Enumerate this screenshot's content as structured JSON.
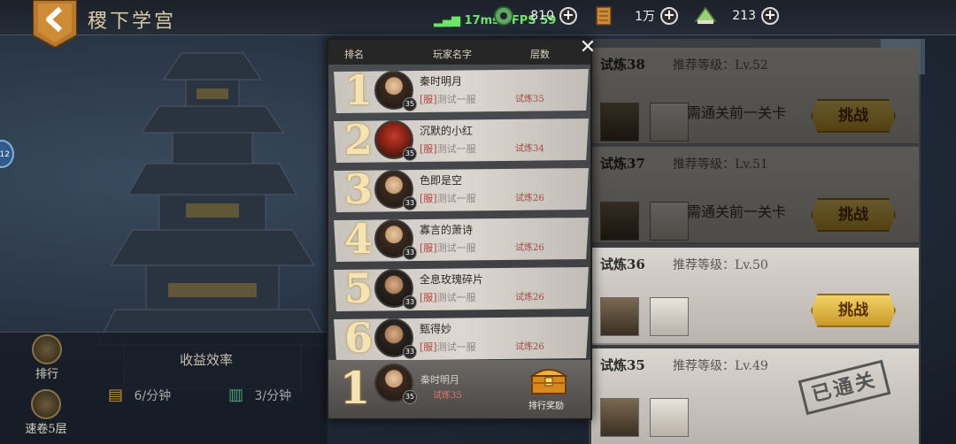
{
  "topbar": {
    "title": "稷下学宫",
    "ping": "17ms · FPS 59",
    "back_icon": "back-arrow-icon"
  },
  "resources": [
    {
      "icon": "jade-icon",
      "value": "810"
    },
    {
      "icon": "scroll-icon",
      "value": "1万"
    },
    {
      "icon": "rice-dumpling-icon",
      "value": "213"
    }
  ],
  "side": {
    "chip": "12",
    "rank_label": "排行",
    "sweep_label": "速卷5层"
  },
  "efficiency": {
    "title": "收益效率",
    "rate1": "6/分钟",
    "rate2": "3/分钟"
  },
  "trials": [
    {
      "name": "试炼38",
      "recommend": "推荐等级：Lv.52",
      "locked": "需通关前一关卡",
      "button": "挑战",
      "dim": true
    },
    {
      "name": "试炼37",
      "recommend": "推荐等级：Lv.51",
      "locked": "需通关前一关卡",
      "button": "挑战",
      "dim": true
    },
    {
      "name": "试炼36",
      "recommend": "推荐等级：Lv.50",
      "locked": "",
      "button": "挑战",
      "dim": false
    },
    {
      "name": "试炼35",
      "recommend": "推荐等级：Lv.49",
      "locked": "",
      "button": "",
      "stamp": "已通关",
      "dim": false
    }
  ],
  "leaderboard": {
    "headers": {
      "rank": "排名",
      "player": "玩家名字",
      "floor": "层数"
    },
    "server_tag": "[服]",
    "server_name": "测试一服",
    "rows": [
      {
        "rank": "1",
        "name": "秦时明月",
        "level": "35",
        "floor": "试炼35"
      },
      {
        "rank": "2",
        "name": "沉默的小红",
        "level": "35",
        "floor": "试炼34"
      },
      {
        "rank": "3",
        "name": "色即是空",
        "level": "33",
        "floor": "试炼26"
      },
      {
        "rank": "4",
        "name": "寡言的萧诗",
        "level": "33",
        "floor": "试炼26"
      },
      {
        "rank": "5",
        "name": "全息玫瑰碎片",
        "level": "33",
        "floor": "试炼26"
      },
      {
        "rank": "6",
        "name": "甄得妙",
        "level": "33",
        "floor": "试炼26"
      }
    ],
    "mine": {
      "rank": "1",
      "name": "秦时明月",
      "level": "35",
      "floor": "试炼35",
      "reward_label": "排行奖励"
    }
  },
  "colors": {
    "gold": "#f5e3b3",
    "accent": "#c99a2a"
  }
}
